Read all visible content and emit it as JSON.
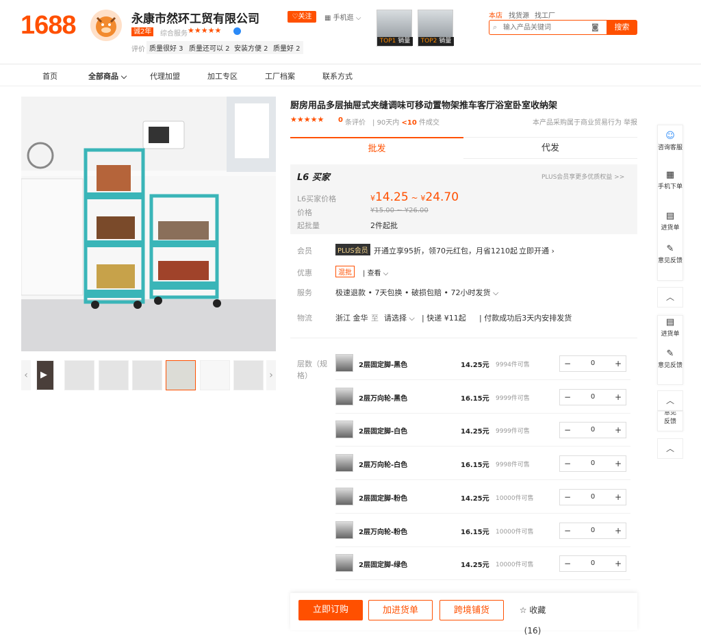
{
  "header": {
    "logo": "1688",
    "shop_name": "永康市然环工贸有限公司",
    "shop_years": "诚2年",
    "service_label": "综合服务",
    "stars": "★★★★★",
    "eval_label": "评价",
    "eval_tags": [
      "质量很好 3",
      "质量还可以 2",
      "安装方便 2",
      "质量好 2"
    ],
    "follow_label": "♡关注",
    "mobile_label": "手机逛",
    "top_items": [
      {
        "tag_a": "TOP1",
        "tag_b": "销量"
      },
      {
        "tag_a": "TOP2",
        "tag_b": "销量"
      }
    ],
    "search_tabs": [
      "本店",
      "找货源",
      "找工厂"
    ],
    "search_placeholder": "输入产品关键词",
    "search_button": "搜索"
  },
  "nav": {
    "items": [
      "首页",
      "全部商品",
      "代理加盟",
      "加工专区",
      "工厂档案",
      "联系方式"
    ]
  },
  "product": {
    "title": "厨房用品多层抽屉式夹缝调味可移动置物架推车客厅浴室卧室收纳架",
    "rating_stars": "★★★★★",
    "review_count": "0",
    "review_label": "条评价",
    "sales_label": "90天内",
    "sales_value": "<10",
    "sales_unit": "件成交",
    "trade_note": "本产品采购属于商业贸易行为",
    "report": "举报",
    "tabs": [
      "批发",
      "代发"
    ],
    "buyer_level": "L6 买家",
    "plus_link": "PLUS会员享更多优质权益 >>",
    "price_label": "L6买家价格",
    "price_low": "14.25",
    "price_high": "24.70",
    "yuan": "¥",
    "orig_label": "价格",
    "orig_price": "¥15.00 ~ ¥26.00",
    "moq_label": "起批量",
    "moq_value": "2件起批",
    "member_label": "会员",
    "plus_badge": "PLUS会员",
    "plus_text": "开通立享95折，领70元红包，月省1210起",
    "plus_open": "立即开通",
    "promo_label": "优惠",
    "promo_tag": "混批",
    "promo_view": "查看",
    "service_label": "服务",
    "service_text": "极速退款 • 7天包换 • 破损包赔 • 72小时发货",
    "logistics_label": "物流",
    "ship_from": "浙江 金华",
    "ship_to_word": "至",
    "ship_select": "请选择",
    "express": "快递 ¥11起",
    "ship_note": "付款成功后3天内安排发货",
    "spec_label": "层数（规格）"
  },
  "skus": [
    {
      "name": "2层固定脚-黑色",
      "price": "14.25元",
      "stock": "9994件可售",
      "qty": "0"
    },
    {
      "name": "2层万向轮-黑色",
      "price": "16.15元",
      "stock": "9999件可售",
      "qty": "0"
    },
    {
      "name": "2层固定脚-白色",
      "price": "14.25元",
      "stock": "9999件可售",
      "qty": "0"
    },
    {
      "name": "2层万向轮-白色",
      "price": "16.15元",
      "stock": "9998件可售",
      "qty": "0"
    },
    {
      "name": "2层固定脚-粉色",
      "price": "14.25元",
      "stock": "10000件可售",
      "qty": "0"
    },
    {
      "name": "2层万向轮-粉色",
      "price": "16.15元",
      "stock": "10000件可售",
      "qty": "0"
    },
    {
      "name": "2层固定脚-绿色",
      "price": "14.25元",
      "stock": "10000件可售",
      "qty": "0"
    }
  ],
  "bottom": {
    "order": "立即订购",
    "add_cart": "加进货单",
    "cross_border": "跨境铺货",
    "favorite": "☆ 收藏(16)"
  },
  "sidebar": {
    "top": [
      {
        "icon": "☺",
        "label": "咨询客服"
      },
      {
        "icon": "▦",
        "label": "手机下单"
      },
      {
        "icon": "▤",
        "label": "进货单"
      },
      {
        "icon": "✎",
        "label": "意见反馈"
      }
    ],
    "mid": [
      {
        "icon": "▤",
        "label": "进货单"
      },
      {
        "icon": "✎",
        "label": "意见反馈"
      }
    ],
    "partial": "意见反馈"
  },
  "colors": {
    "brand": "#ff5000",
    "teal": "#3ab5b8"
  }
}
